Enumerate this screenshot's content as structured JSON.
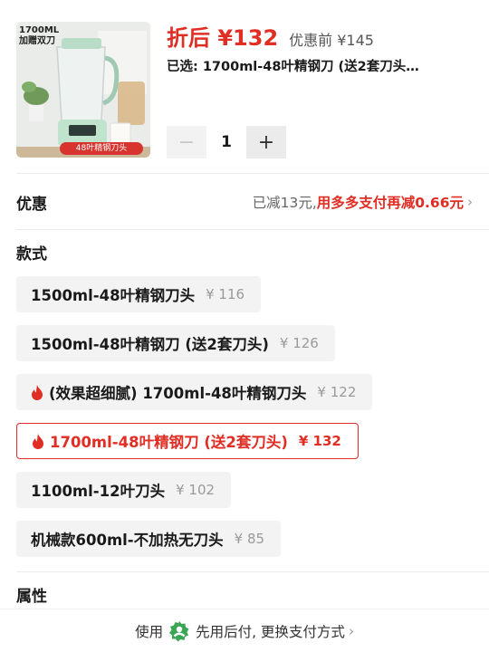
{
  "product": {
    "image_text": "1700ML\n加赠双刀",
    "image_badge": "48叶精钢刀头",
    "price_now": "折后 ¥132",
    "price_original": "优惠前 ¥145",
    "selected_text": "已选: 1700ml-48叶精钢刀 (送2套刀头…",
    "quantity": "1",
    "minus_symbol": "−",
    "plus_symbol": "+"
  },
  "discount": {
    "title": "优惠",
    "reduced_text": "已减13元,",
    "extra_text": "用多多支付再减0.66元",
    "chevron": "›"
  },
  "style_section": {
    "title": "款式",
    "options": [
      {
        "label": "1500ml-48叶精钢刀头",
        "price": "¥ 116",
        "hot": false,
        "selected": false
      },
      {
        "label": "1500ml-48叶精钢刀 (送2套刀头)",
        "price": "¥ 126",
        "hot": false,
        "selected": false
      },
      {
        "label": "(效果超细腻) 1700ml-48叶精钢刀头",
        "price": "¥ 122",
        "hot": true,
        "selected": false
      },
      {
        "label": "1700ml-48叶精钢刀 (送2套刀头)",
        "price": "¥ 132",
        "hot": true,
        "selected": true
      },
      {
        "label": "1100ml-12叶刀头",
        "price": "¥ 102",
        "hot": false,
        "selected": false
      },
      {
        "label": "机械款600ml-不加热无刀头",
        "price": "¥ 85",
        "hot": false,
        "selected": false
      }
    ]
  },
  "attributes_section": {
    "title": "属性"
  },
  "bottom_bar": {
    "prefix": "使用",
    "text": "先用后付, 更换支付方式",
    "chevron": "›"
  },
  "colors": {
    "accent_red": "#e02e24",
    "pay_green": "#3aa655"
  },
  "icons": {
    "fire": "fire-icon",
    "pay": "pay-later-icon",
    "chevron": "chevron-right-icon"
  }
}
